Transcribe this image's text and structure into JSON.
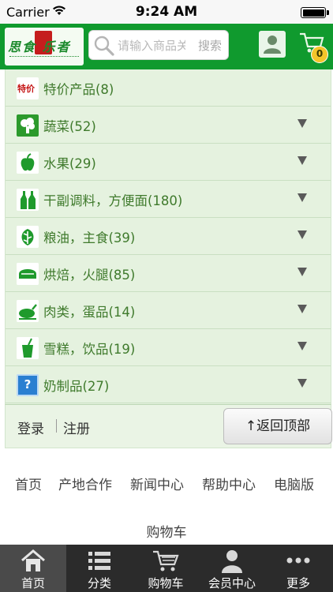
{
  "status_bar": {
    "carrier": "Carrier",
    "time": "9:24 AM"
  },
  "header": {
    "logo_text": "思食 乐者",
    "search_placeholder": "请输入商品关键字",
    "search_button": "搜索",
    "cart_count": "0"
  },
  "categories": [
    {
      "icon_text": "特价",
      "label": "特价产品(8)",
      "icon": "special-offer-icon",
      "expandable": false
    },
    {
      "label": "蔬菜(52)",
      "icon": "broccoli-icon",
      "expandable": true
    },
    {
      "label": "水果(29)",
      "icon": "apple-icon",
      "expandable": true
    },
    {
      "label": "干副调料，方便面(180)",
      "icon": "bottles-icon",
      "expandable": true
    },
    {
      "label": "粮油，主食(39)",
      "icon": "grain-icon",
      "expandable": true
    },
    {
      "label": "烘焙，火腿(85)",
      "icon": "bread-icon",
      "expandable": true
    },
    {
      "label": "肉类，蛋品(14)",
      "icon": "roast-chicken-icon",
      "expandable": true
    },
    {
      "label": "雪糕，饮品(19)",
      "icon": "drink-icon",
      "expandable": true
    },
    {
      "icon_text": "?",
      "label": "奶制品(27)",
      "icon": "question-icon",
      "expandable": true
    }
  ],
  "login_strip": {
    "login": "登录",
    "register": "注册",
    "back_to_top": "↑返回顶部"
  },
  "footer_links": {
    "home": "首页",
    "origin": "产地合作",
    "news": "新闻中心",
    "help": "帮助中心",
    "desktop": "电脑版",
    "cart": "购物车"
  },
  "tab_bar": [
    {
      "label": "首页",
      "icon": "home-icon",
      "active": true
    },
    {
      "label": "分类",
      "icon": "list-icon",
      "active": false
    },
    {
      "label": "购物车",
      "icon": "cart-icon",
      "active": false
    },
    {
      "label": "会员中心",
      "icon": "user-icon",
      "active": false
    },
    {
      "label": "更多",
      "icon": "more-icon",
      "active": false
    }
  ],
  "colors": {
    "header_green": "#109a2e",
    "list_bg": "#e5f2df",
    "label_green": "#3f7a2c",
    "tab_bar": "#2b2b2b"
  }
}
